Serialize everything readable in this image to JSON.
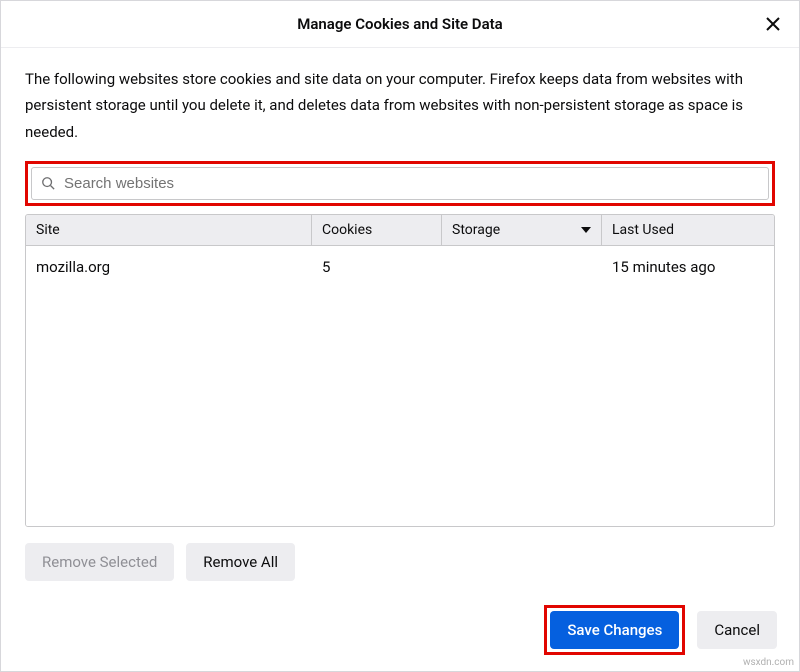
{
  "dialog": {
    "title": "Manage Cookies and Site Data",
    "description": "The following websites store cookies and site data on your computer. Firefox keeps data from websites with persistent storage until you delete it, and deletes data from websites with non-persistent storage as space is needed."
  },
  "search": {
    "placeholder": "Search websites"
  },
  "columns": {
    "site": "Site",
    "cookies": "Cookies",
    "storage": "Storage",
    "lastUsed": "Last Used"
  },
  "rows": [
    {
      "site": "mozilla.org",
      "cookies": "5",
      "storage": "",
      "lastUsed": "15 minutes ago"
    }
  ],
  "buttons": {
    "removeSelected": "Remove Selected",
    "removeAll": "Remove All",
    "save": "Save Changes",
    "cancel": "Cancel"
  },
  "watermark": "wsxdn.com"
}
